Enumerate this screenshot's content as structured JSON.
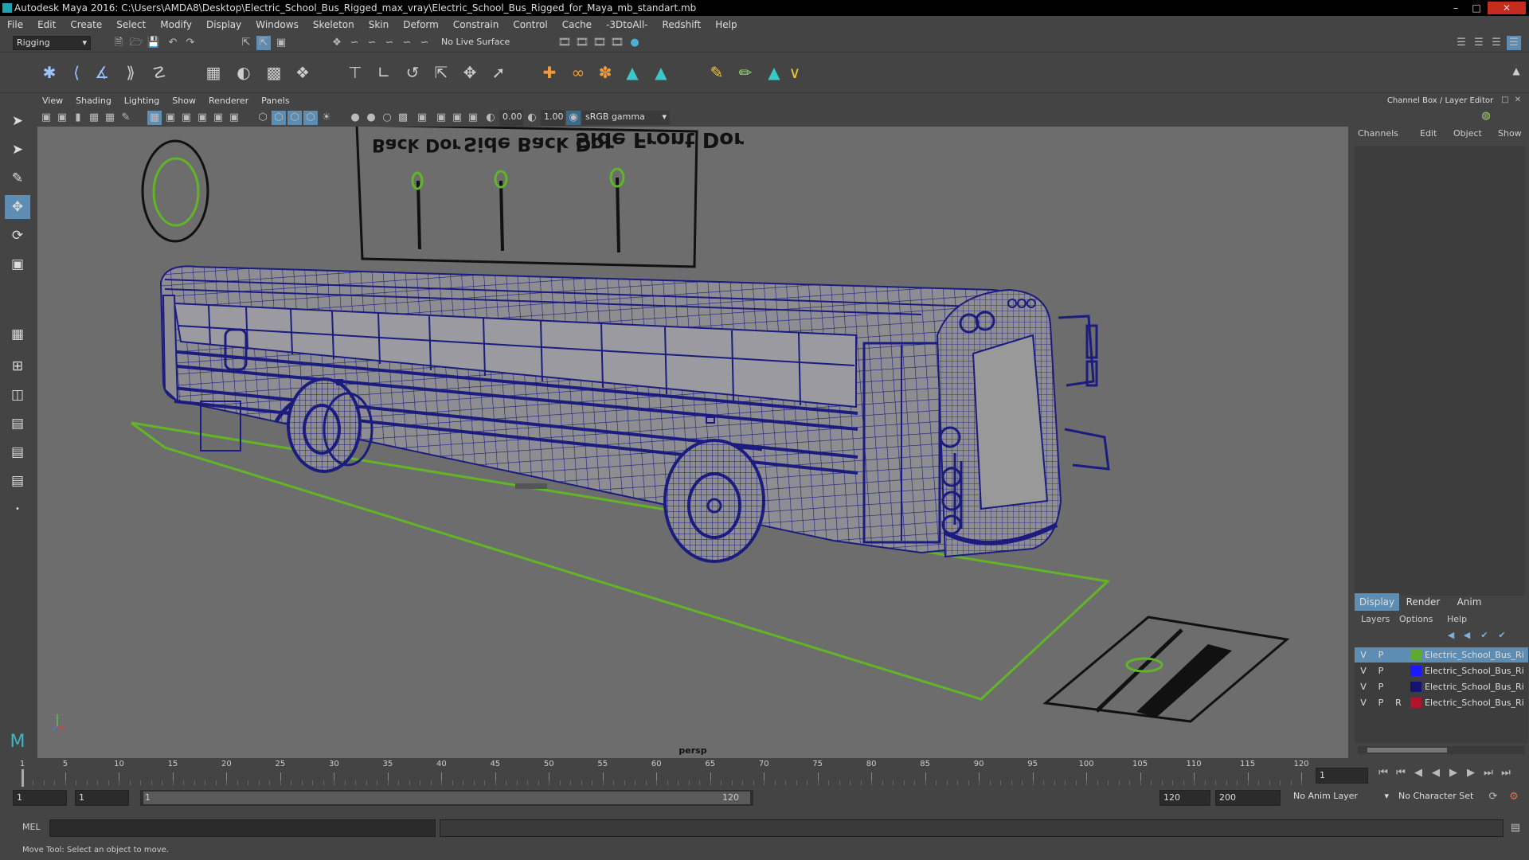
{
  "window": {
    "title": "Autodesk Maya 2016: C:\\Users\\AMDA8\\Desktop\\Electric_School_Bus_Rigged_max_vray\\Electric_School_Bus_Rigged_for_Maya_mb_standart.mb"
  },
  "menubar": [
    "File",
    "Edit",
    "Create",
    "Select",
    "Modify",
    "Display",
    "Windows",
    "Skeleton",
    "Skin",
    "Deform",
    "Constrain",
    "Control",
    "Cache",
    "-3DtoAll-",
    "Redshift",
    "Help"
  ],
  "statusline": {
    "menuset": "Rigging",
    "live_surface": "No Live Surface"
  },
  "panel_menu": [
    "View",
    "Shading",
    "Lighting",
    "Show",
    "Renderer",
    "Panels"
  ],
  "panel_toolbar": {
    "exposure": "0.00",
    "gamma": "1.00",
    "colorspace": "sRGB gamma"
  },
  "viewport": {
    "camera_label": "persp",
    "board_labels": [
      "Side Front Dor",
      "Side Back Dor",
      "Back Dor"
    ]
  },
  "channelbox": {
    "header": "Channel Box / Layer Editor",
    "menu": [
      "Channels",
      "Edit",
      "Object",
      "Show"
    ],
    "tabs": [
      "Display",
      "Render",
      "Anim"
    ],
    "layer_menu": [
      "Layers",
      "Options",
      "Help"
    ],
    "layers": [
      {
        "v": "V",
        "p": "P",
        "r": "",
        "color": "#5fa831",
        "name": "Electric_School_Bus_Ri",
        "selected": true
      },
      {
        "v": "V",
        "p": "P",
        "r": "",
        "color": "#1a1aff",
        "name": "Electric_School_Bus_Ri",
        "selected": false
      },
      {
        "v": "V",
        "p": "P",
        "r": "",
        "color": "#141470",
        "name": "Electric_School_Bus_Ri",
        "selected": false
      },
      {
        "v": "V",
        "p": "P",
        "r": "R",
        "color": "#b0142a",
        "name": "Electric_School_Bus_Ri",
        "selected": false
      }
    ]
  },
  "timeline": {
    "ticks": [
      "1",
      "5",
      "10",
      "15",
      "20",
      "25",
      "30",
      "35",
      "40",
      "45",
      "50",
      "55",
      "60",
      "65",
      "70",
      "75",
      "80",
      "85",
      "90",
      "95",
      "100",
      "105",
      "110",
      "115",
      "120"
    ],
    "current_frame": "1"
  },
  "rangebar": {
    "start": "1",
    "playback_start": "1",
    "slider_start": "1",
    "slider_end": "120",
    "playback_end": "120",
    "end": "200",
    "anim_layer": "No Anim Layer",
    "character_set": "No Character Set"
  },
  "mel": {
    "label": "MEL"
  },
  "helpline": "Move Tool: Select an object to move."
}
